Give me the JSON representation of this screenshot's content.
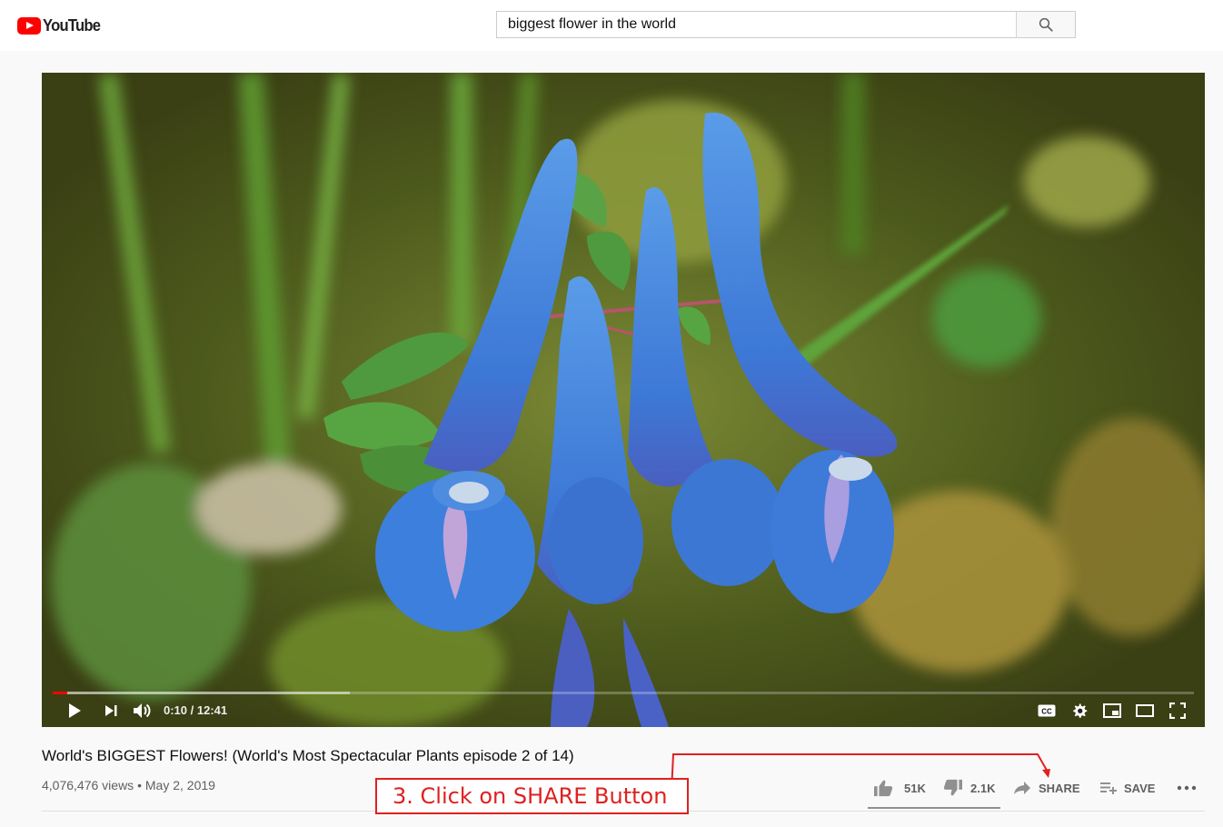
{
  "header": {
    "logo_text": "YouTube",
    "search_value": "biggest flower in the world",
    "search_icon": "search-icon"
  },
  "player": {
    "time_display": "0:10 / 12:41",
    "played_fraction": 0.013,
    "buffered_fraction": 0.26,
    "icons": [
      "play-icon",
      "next-icon",
      "volume-icon",
      "captions-icon",
      "settings-icon",
      "miniplayer-icon",
      "theater-icon",
      "fullscreen-icon"
    ]
  },
  "video": {
    "title": "World's BIGGEST Flowers! (World's Most Spectacular Plants episode 2 of 14)",
    "views": "4,076,476 views",
    "separator": " • ",
    "date": "May 2, 2019"
  },
  "actions": {
    "likes": "51K",
    "dislikes": "2.1K",
    "share_label": "SHARE",
    "save_label": "SAVE",
    "like_ratio": 0.96
  },
  "annotation": {
    "text": "3. Click on SHARE Button",
    "color": "#e02020"
  },
  "colors": {
    "brand_red": "#ff0000",
    "flower_blue": "#3f7fdc"
  }
}
